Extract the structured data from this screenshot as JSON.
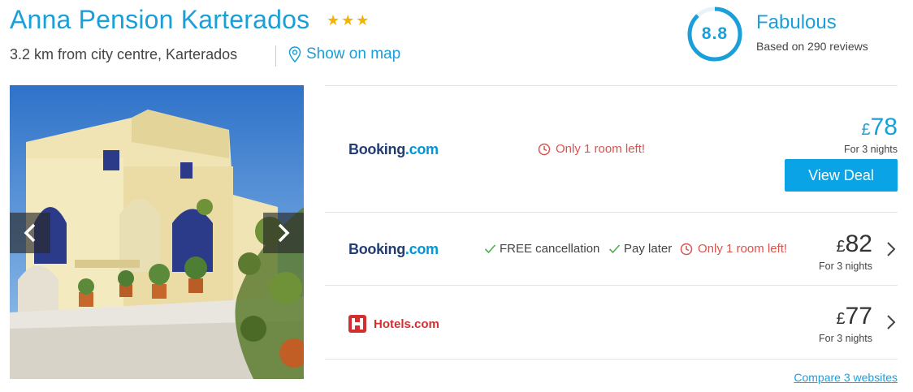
{
  "hotel": {
    "name": "Anna Pension Karterados",
    "stars": 3,
    "location": "3.2 km from city centre, Karterados",
    "map_link": "Show on map"
  },
  "rating": {
    "score": "8.8",
    "label": "Fabulous",
    "reviews": "Based on 290 reviews",
    "fraction": 0.88
  },
  "deals": [
    {
      "provider": {
        "name": "Booking",
        "suffix": ".com"
      },
      "features": [],
      "urgency": "Only 1 room left!",
      "price": {
        "currency": "£",
        "amount": "78",
        "nights": "For 3 nights"
      },
      "cta": "View Deal"
    },
    {
      "provider": {
        "name": "Booking",
        "suffix": ".com"
      },
      "features": [
        "FREE cancellation",
        "Pay later"
      ],
      "urgency": "Only 1 room left!",
      "price": {
        "currency": "£",
        "amount": "82",
        "nights": "For 3 nights"
      }
    },
    {
      "provider": {
        "name": "Hotels.com"
      },
      "features": [],
      "price": {
        "currency": "£",
        "amount": "77",
        "nights": "For 3 nights"
      }
    }
  ],
  "compare_link": "Compare 3 websites",
  "colors": {
    "accent": "#1a9fd9",
    "cta": "#0aa3e6",
    "urgent": "#d9534f",
    "check": "#4caf50",
    "star": "#f5b301"
  },
  "icons": {
    "star": "star-icon",
    "map": "map-pin-icon",
    "clock": "clock-icon",
    "check": "check-icon",
    "chevron": "chevron-right-icon",
    "prev": "chevron-left-icon",
    "next": "chevron-right-icon",
    "hotels_logo": "hotels-logo-icon"
  }
}
